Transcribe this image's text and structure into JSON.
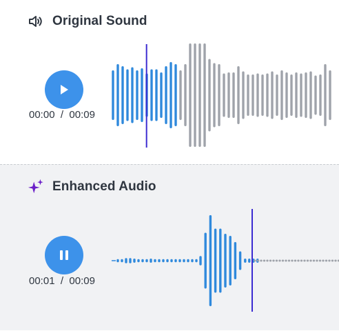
{
  "original": {
    "title": "Original Sound",
    "time_current": "00:00",
    "time_separator": "/",
    "time_total": "00:09",
    "control": "play",
    "progress_fraction": 0.24,
    "bars_played": [
      0.48,
      0.6,
      0.56,
      0.5,
      0.54,
      0.48,
      0.52,
      0.42,
      0.5,
      0.5,
      0.44,
      0.56,
      0.64,
      0.6
    ],
    "bars_unplayed": [
      0.48,
      0.6,
      1.0,
      1.0,
      1.0,
      1.0,
      0.7,
      0.62,
      0.6,
      0.42,
      0.44,
      0.44,
      0.56,
      0.46,
      0.4,
      0.4,
      0.42,
      0.4,
      0.42,
      0.46,
      0.4,
      0.48,
      0.44,
      0.4,
      0.44,
      0.42,
      0.44,
      0.46,
      0.38,
      0.4,
      0.6,
      0.48
    ]
  },
  "enhanced": {
    "title": "Enhanced Audio",
    "time_current": "00:01",
    "time_separator": "/",
    "time_total": "00:09",
    "control": "pause",
    "progress_fraction": 0.6,
    "bars_active": [
      0.03,
      0.03,
      0.05,
      0.05,
      0.04,
      0.03,
      0.03,
      0.03,
      0.04,
      0.03,
      0.03,
      0.03,
      0.03,
      0.03,
      0.03,
      0.03,
      0.03,
      0.03,
      0.03,
      0.03,
      0.09,
      0.54,
      0.88,
      0.62,
      0.62,
      0.52,
      0.48,
      0.36,
      0.18,
      0.04,
      0.04,
      0.04,
      0.04
    ],
    "bars_inactive_count": 28
  },
  "colors": {
    "played": "#2f89dc",
    "unplayed": "#9fa3aa",
    "playhead": "#3b2bd1",
    "button": "#3d92ea",
    "sparkle": "#6b1fc8"
  }
}
